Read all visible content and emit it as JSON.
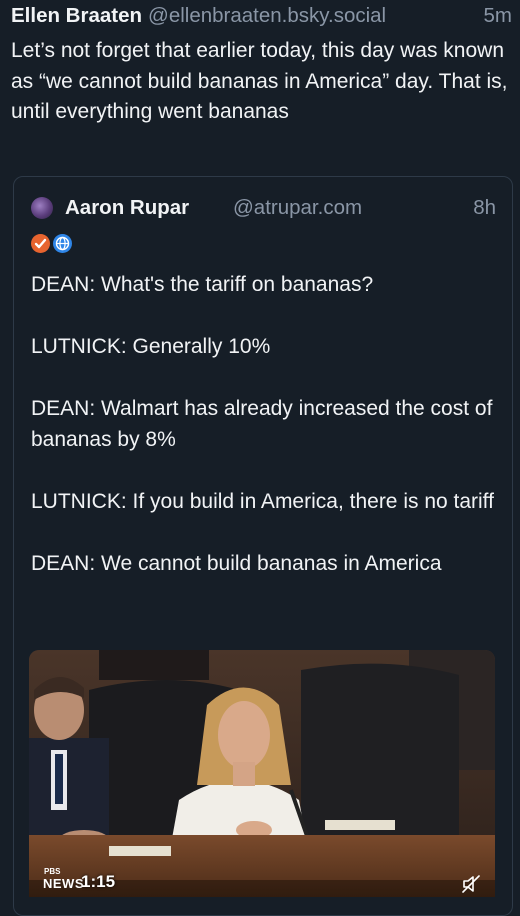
{
  "post": {
    "author_name": "Ellen Braaten",
    "author_handle": "@ellenbraaten.bsky.social",
    "time": "5m",
    "text": "Let’s not forget that earlier today, this day was known as “we cannot build bananas in America” day. That is, until everything went bananas"
  },
  "quote": {
    "author_name": "Aaron Rupar",
    "author_handle": "@atrupar.com",
    "time": "8h",
    "badges": [
      "verified-check-icon",
      "globe-icon"
    ],
    "lines": [
      "DEAN: What's the tariff on bananas?",
      "LUTNICK: Generally 10%",
      "DEAN: Walmart has already increased the cost of bananas by 8%",
      "LUTNICK: If you build in America, there is no tariff",
      "DEAN: We cannot build bananas in America"
    ],
    "video": {
      "network_small": "PBS",
      "network_main": "NEWS",
      "timestamp": "1:15",
      "mute_icon": "speaker-muted-icon"
    }
  },
  "colors": {
    "background": "#161e27",
    "text": "#f1f3f5",
    "muted_text": "#8a96a6",
    "card_border": "#2e3a48",
    "check_badge": "#e7642f",
    "globe_badge": "#2f86e8"
  }
}
